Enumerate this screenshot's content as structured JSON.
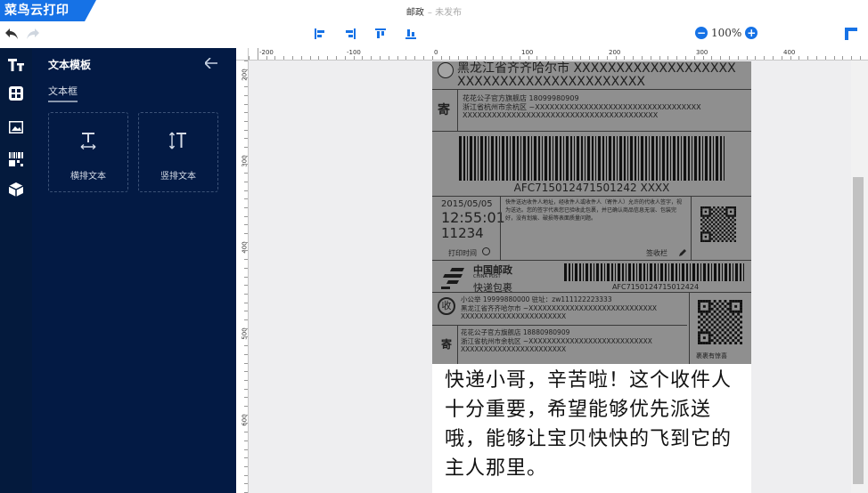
{
  "app": {
    "name": "菜鸟云打印",
    "doc_title": "邮政",
    "doc_status": "– 未发布"
  },
  "toolbar": {
    "zoom": "100%",
    "zoom_minus": "−",
    "zoom_plus": "+"
  },
  "panel": {
    "title": "文本模板",
    "tab": "文本框",
    "tools": [
      {
        "label": "横排文本"
      },
      {
        "label": "竖排文本"
      }
    ]
  },
  "ruler": {
    "h_labels": [
      "-200",
      "-100",
      "0",
      "100",
      "200",
      "300",
      "400"
    ],
    "v_labels": [
      "200",
      "300",
      "400",
      "500",
      "600"
    ]
  },
  "label": {
    "top_address": "黑龙江省齐齐哈尔市 XXXXXXXXXXXXXXXXXXX XXXXXXXXXXXXXXXXXXXXXX",
    "sender_badge": "寄",
    "sender_line1": "花花公子官方旗舰店   18099980909",
    "sender_line2": "浙江省杭州市余杭区 ~XXXXXXXXXXXXXXXXXXXXXXXXXXXXXXXXXX",
    "sender_line3": "XXXXXXXXXXXXXXXXXXXXXXXXXXXXXXXXXXXXXXXX",
    "barcode_text": "AFC715012471501242 XXXX",
    "date": "2015/05/05",
    "time": "12:55:01",
    "code": "11234",
    "notice": "快件送达收件人地址，经收件人或收件人（寄件人）允许的代收人签字，视为送达。您的签字代表您已验收此包裹，并已确认商品信息无误、包装完好，没有划痕、破损等表面质量问题。",
    "print_time": "打印时间",
    "sign": "签收栏",
    "post_name": "中国邮政",
    "post_en": "CHINA POST",
    "post_service": "快递包裹",
    "barcode2_text": "AFC7150124715012424",
    "recv_badge": "收",
    "recv_line1": "小公举   19999880000   驻址：zw111122223333",
    "recv_line2": "黑龙江省齐齐哈尔市 ~XXXXXXXXXXXXXXXXXXXXXXXXXXXX",
    "recv_line3": "XXXXXXXXXXXXXXXXXXXXXXX",
    "send2_badge": "寄",
    "send2_line1": "花花公子官方旗舰店   18880980909",
    "send2_line2": "浙江省杭州市余杭区 ~XXXXXXXXXXXXXXXXXXXXXXXXXXX",
    "send2_line3": "XXXXXXXXXXXXXXXXXXXXXXX",
    "qr_caption": "裹裹有惊喜",
    "message": "快递小哥，辛苦啦！这个收件人十分重要，希望能够优先派送哦，能够让宝贝快快的飞到它的主人那里。"
  }
}
